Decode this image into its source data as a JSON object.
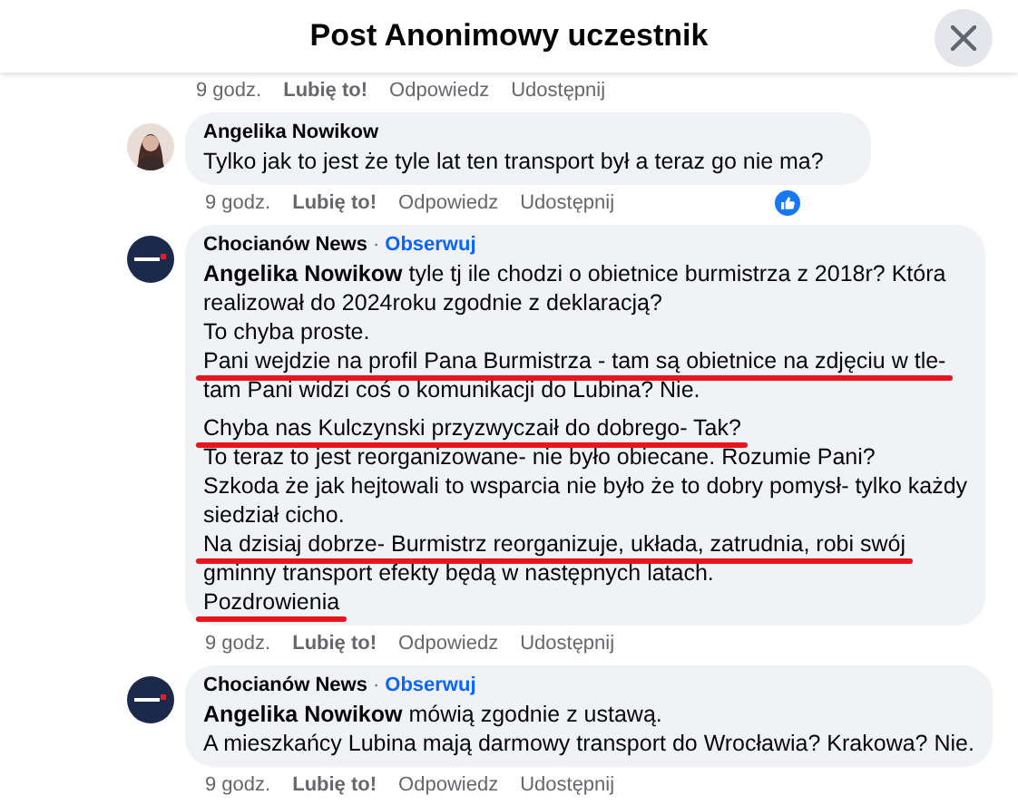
{
  "header": {
    "title": "Post Anonimowy uczestnik"
  },
  "top_actions": {
    "time": "9 godz.",
    "like": "Lubię to!",
    "reply": "Odpowiedz",
    "share": "Udostępnij"
  },
  "comments": [
    {
      "author": "Angelika Nowikow",
      "kind": "photo",
      "reaction": true,
      "paragraphs": [
        [
          {
            "text": "Tylko jak to jest że tyle lat ten transport był a teraz go nie ma?",
            "underlined": false
          }
        ]
      ],
      "actions": {
        "time": "9 godz.",
        "like": "Lubię to!",
        "reply": "Odpowiedz",
        "share": "Udostępnij"
      }
    },
    {
      "author": "Chocianów News",
      "separator": "·",
      "follow": "Obserwuj",
      "kind": "logo",
      "reaction": false,
      "paragraphs": [
        [
          {
            "text": "**Angelika Nowikow** tyle tj ile chodzi o obietnice burmistrza z 2018r? Która",
            "underlined": false
          },
          {
            "text": "realizował do 2024roku zgodnie z deklaracją?",
            "underlined": false
          },
          {
            "text": "To chyba proste.",
            "underlined": false
          },
          {
            "text": "Pani wejdzie na profil Pana Burmistrza - tam są obietnice na zdjęciu w tle-",
            "underlined": true
          },
          {
            "text": "tam Pani widzi coś o komunikacji do Lubina? Nie.",
            "underlined": false
          }
        ],
        [
          {
            "text": "Chyba nas Kulczynski przyzwyczaił do dobrego- Tak?",
            "underlined": true
          },
          {
            "text": "To teraz to jest reorganizowane- nie było obiecane. Rozumie Pani?",
            "underlined": false
          },
          {
            "text": "Szkoda że jak hejtowali to wsparcia nie było że to dobry pomysł- tylko każdy",
            "underlined": false
          },
          {
            "text": "siedział cicho.",
            "underlined": false
          },
          {
            "text": "Na dzisiaj dobrze- Burmistrz reorganizuje, układa, zatrudnia, robi swój",
            "underlined": true
          },
          {
            "text": "gminny transport efekty będą w następnych latach.",
            "underlined": false
          },
          {
            "text": "Pozdrowienia",
            "underlined": true
          }
        ]
      ],
      "actions": {
        "time": "9 godz.",
        "like": "Lubię to!",
        "reply": "Odpowiedz",
        "share": "Udostępnij"
      }
    },
    {
      "author": "Chocianów News",
      "separator": "·",
      "follow": "Obserwuj",
      "kind": "logo",
      "reaction": false,
      "paragraphs": [
        [
          {
            "text": "**Angelika Nowikow** mówią zgodnie z ustawą.",
            "underlined": false
          },
          {
            "text": "A mieszkańcy Lubina mają darmowy transport do Wrocławia? Krakowa? Nie.",
            "underlined": false
          }
        ]
      ],
      "actions": {
        "time": "9 godz.",
        "like": "Lubię to!",
        "reply": "Odpowiedz",
        "share": "Udostępnij"
      }
    }
  ]
}
